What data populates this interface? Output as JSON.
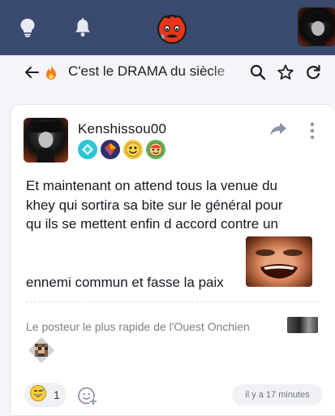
{
  "topbar": {
    "icons": [
      "lightbulb-icon",
      "bell-icon",
      "site-logo-icon",
      "user-avatar"
    ]
  },
  "topic": {
    "title": "C'est le DRAMA du siècle",
    "icons": [
      "back-arrow-icon",
      "fire-icon",
      "search-icon",
      "star-icon",
      "refresh-icon"
    ]
  },
  "post": {
    "author": "Kenshissou00",
    "badges": [
      "diamond-badge",
      "gem-badge",
      "smiley-badge",
      "emoji-badge"
    ],
    "body_lines": [
      "Et maintenant on attend tous la venue du",
      "khey qui sortira sa bite sur le général pour",
      "qu ils se mettent enfin d accord contre un"
    ],
    "body_last": "ennemi commun et fasse la paix",
    "signature": "Le posteur le plus rapide de l'Ouest Onchien",
    "reaction": {
      "emoji": "grinning-sweat-emoji",
      "count": "1"
    },
    "timestamp": "il y a 17 minutes"
  },
  "colors": {
    "topbar": "#3a4a6e",
    "background": "#f4f5f8",
    "card": "#ffffff",
    "accent": "#3a4a6e"
  }
}
